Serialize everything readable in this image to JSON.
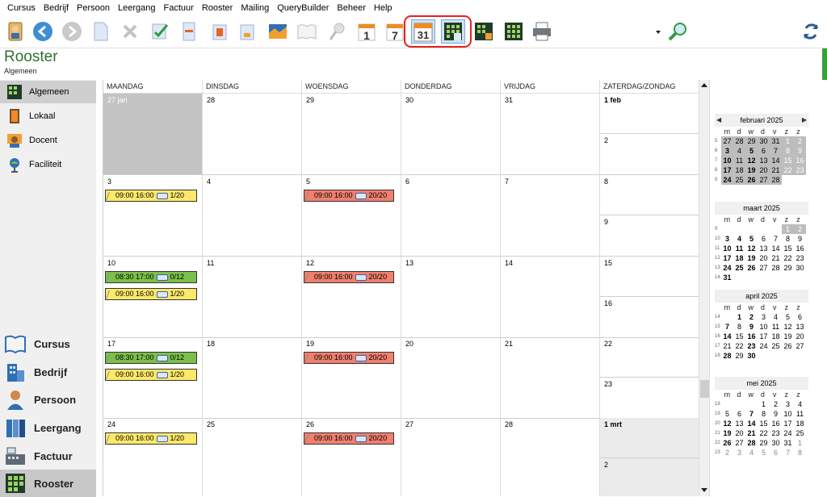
{
  "menu": [
    "Cursus",
    "Bedrijf",
    "Persoon",
    "Leergang",
    "Factuur",
    "Rooster",
    "Mailing",
    "QueryBuilder",
    "Beheer",
    "Help"
  ],
  "toolbar": {
    "icons": [
      "person-badge-icon",
      "back-icon",
      "forward-icon",
      "new-document-icon",
      "delete-icon",
      "approve-icon",
      "form-icon",
      "import-icon",
      "export-icon",
      "map-icon",
      "book-icon",
      "pin-icon",
      "calendar-day-icon",
      "calendar-week-icon",
      "calendar-month-icon",
      "schedule-grid-icon",
      "schedule-orange-icon",
      "schedule-green-icon",
      "print-icon",
      "search-icon",
      "refresh-icon"
    ],
    "day_label": "1",
    "week_label": "7",
    "month_label": "31",
    "highlight_color": "#e8201f"
  },
  "page": {
    "title": "Rooster",
    "subtitle": "Algemeen"
  },
  "sidebar": {
    "top_items": [
      {
        "label": "Algemeen",
        "icon": "schedule-grid-icon",
        "selected": true
      },
      {
        "label": "Lokaal",
        "icon": "door-icon",
        "selected": false
      },
      {
        "label": "Docent",
        "icon": "teacher-icon",
        "selected": false
      },
      {
        "label": "Faciliteit",
        "icon": "projector-icon",
        "selected": false
      }
    ],
    "bottom_items": [
      {
        "label": "Cursus",
        "icon": "book-icon",
        "selected": false
      },
      {
        "label": "Bedrijf",
        "icon": "building-icon",
        "selected": false
      },
      {
        "label": "Persoon",
        "icon": "person-icon",
        "selected": false
      },
      {
        "label": "Leergang",
        "icon": "binders-icon",
        "selected": false
      },
      {
        "label": "Factuur",
        "icon": "cash-register-icon",
        "selected": false
      },
      {
        "label": "Rooster",
        "icon": "schedule-grid-icon",
        "selected": true
      }
    ]
  },
  "calendar": {
    "headers": [
      "MAANDAG",
      "DINSDAG",
      "WOENSDAG",
      "DONDERDAG",
      "VRIJDAG",
      "ZATERDAG/ZONDAG"
    ],
    "weeks": [
      {
        "days": [
          "27 jan",
          "28",
          "29",
          "30",
          "31"
        ],
        "sat": "1 feb",
        "sun": "2",
        "events": []
      },
      {
        "days": [
          "3",
          "4",
          "5",
          "6",
          "7"
        ],
        "sat": "8",
        "sun": "9",
        "events": [
          {
            "day": 0,
            "slot": 0,
            "color": "y",
            "time": "09:00 16:00",
            "count": "1/20"
          },
          {
            "day": 2,
            "slot": 0,
            "color": "r",
            "time": "09:00 16:00",
            "count": "20/20"
          }
        ]
      },
      {
        "days": [
          "10",
          "11",
          "12",
          "13",
          "14"
        ],
        "sat": "15",
        "sun": "16",
        "events": [
          {
            "day": 0,
            "slot": 0,
            "color": "g",
            "time": "08:30 17:00",
            "count": "0/12"
          },
          {
            "day": 0,
            "slot": 1,
            "color": "y",
            "time": "09:00 16:00",
            "count": "1/20"
          },
          {
            "day": 2,
            "slot": 0,
            "color": "r",
            "time": "09:00 16:00",
            "count": "20/20"
          }
        ]
      },
      {
        "days": [
          "17",
          "18",
          "19",
          "20",
          "21"
        ],
        "sat": "22",
        "sun": "23",
        "events": [
          {
            "day": 0,
            "slot": 0,
            "color": "g",
            "time": "08:30 17:00",
            "count": "0/12"
          },
          {
            "day": 0,
            "slot": 1,
            "color": "y",
            "time": "09:00 16:00",
            "count": "1/20"
          },
          {
            "day": 2,
            "slot": 0,
            "color": "r",
            "time": "09:00 16:00",
            "count": "20/20"
          }
        ]
      },
      {
        "days": [
          "24",
          "25",
          "26",
          "27",
          "28"
        ],
        "sat": "1 mrt",
        "sun": "2",
        "events": [
          {
            "day": 0,
            "slot": 0,
            "color": "y",
            "time": "09:00 16:00",
            "count": "1/20"
          },
          {
            "day": 2,
            "slot": 0,
            "color": "r",
            "time": "09:00 16:00",
            "count": "20/20"
          }
        ]
      }
    ]
  },
  "minicals": [
    {
      "title": "februari 2025",
      "nav": true,
      "weekdays": [
        "m",
        "d",
        "w",
        "d",
        "v",
        "z",
        "z"
      ],
      "weeks": [
        {
          "wn": "5",
          "days": [
            [
              "27",
              "g"
            ],
            [
              "28",
              "g"
            ],
            [
              "29",
              "g"
            ],
            [
              "30",
              "g"
            ],
            [
              "31",
              "g"
            ],
            [
              "1",
              "gw"
            ],
            [
              "2",
              "gw"
            ]
          ]
        },
        {
          "wn": "6",
          "days": [
            [
              "3",
              "gb"
            ],
            [
              "4",
              "g"
            ],
            [
              "5",
              "gb"
            ],
            [
              "6",
              "g"
            ],
            [
              "7",
              "g"
            ],
            [
              "8",
              "gw"
            ],
            [
              "9",
              "gw"
            ]
          ]
        },
        {
          "wn": "7",
          "days": [
            [
              "10",
              "gb"
            ],
            [
              "11",
              "g"
            ],
            [
              "12",
              "gb"
            ],
            [
              "13",
              "g"
            ],
            [
              "14",
              "g"
            ],
            [
              "15",
              "gw"
            ],
            [
              "16",
              "gw"
            ]
          ]
        },
        {
          "wn": "8",
          "days": [
            [
              "17",
              "gb"
            ],
            [
              "18",
              "g"
            ],
            [
              "19",
              "gb"
            ],
            [
              "20",
              "g"
            ],
            [
              "21",
              "g"
            ],
            [
              "22",
              "gw"
            ],
            [
              "23",
              "gw"
            ]
          ]
        },
        {
          "wn": "9",
          "days": [
            [
              "24",
              "gb"
            ],
            [
              "25",
              "g"
            ],
            [
              "26",
              "gb"
            ],
            [
              "27",
              "g"
            ],
            [
              "28",
              "g"
            ],
            [
              "",
              ""
            ],
            [
              "",
              ""
            ]
          ]
        }
      ]
    },
    {
      "title": "maart 2025",
      "nav": false,
      "weekdays": [
        "m",
        "d",
        "w",
        "d",
        "v",
        "z",
        "z"
      ],
      "weeks": [
        {
          "wn": "9",
          "days": [
            [
              "",
              ""
            ],
            [
              "",
              ""
            ],
            [
              "",
              ""
            ],
            [
              "",
              ""
            ],
            [
              "",
              ""
            ],
            [
              "1",
              "gw"
            ],
            [
              "2",
              "gw"
            ]
          ]
        },
        {
          "wn": "10",
          "days": [
            [
              "3",
              "b"
            ],
            [
              "4",
              "b"
            ],
            [
              "5",
              "b"
            ],
            [
              "6",
              ""
            ],
            [
              "7",
              ""
            ],
            [
              "8",
              ""
            ],
            [
              "9",
              ""
            ]
          ]
        },
        {
          "wn": "11",
          "days": [
            [
              "10",
              "b"
            ],
            [
              "11",
              "b"
            ],
            [
              "12",
              "b"
            ],
            [
              "13",
              ""
            ],
            [
              "14",
              ""
            ],
            [
              "15",
              ""
            ],
            [
              "16",
              ""
            ]
          ]
        },
        {
          "wn": "12",
          "days": [
            [
              "17",
              "b"
            ],
            [
              "18",
              "b"
            ],
            [
              "19",
              "b"
            ],
            [
              "20",
              ""
            ],
            [
              "21",
              ""
            ],
            [
              "22",
              ""
            ],
            [
              "23",
              ""
            ]
          ]
        },
        {
          "wn": "13",
          "days": [
            [
              "24",
              "b"
            ],
            [
              "25",
              "b"
            ],
            [
              "26",
              "b"
            ],
            [
              "27",
              ""
            ],
            [
              "28",
              ""
            ],
            [
              "29",
              ""
            ],
            [
              "30",
              ""
            ]
          ]
        },
        {
          "wn": "14",
          "days": [
            [
              "31",
              "b"
            ],
            [
              "",
              ""
            ],
            [
              "",
              ""
            ],
            [
              "",
              ""
            ],
            [
              "",
              ""
            ],
            [
              "",
              ""
            ],
            [
              "",
              ""
            ]
          ]
        }
      ]
    },
    {
      "title": "april 2025",
      "nav": false,
      "weekdays": [
        "m",
        "d",
        "w",
        "d",
        "v",
        "z",
        "z"
      ],
      "weeks": [
        {
          "wn": "14",
          "days": [
            [
              "",
              ""
            ],
            [
              "1",
              "b"
            ],
            [
              "2",
              "b"
            ],
            [
              "3",
              ""
            ],
            [
              "4",
              ""
            ],
            [
              "5",
              ""
            ],
            [
              "6",
              ""
            ]
          ]
        },
        {
          "wn": "15",
          "days": [
            [
              "7",
              "b"
            ],
            [
              "8",
              ""
            ],
            [
              "9",
              "b"
            ],
            [
              "10",
              ""
            ],
            [
              "11",
              ""
            ],
            [
              "12",
              ""
            ],
            [
              "13",
              ""
            ]
          ]
        },
        {
          "wn": "16",
          "days": [
            [
              "14",
              "b"
            ],
            [
              "15",
              ""
            ],
            [
              "16",
              "b"
            ],
            [
              "17",
              ""
            ],
            [
              "18",
              ""
            ],
            [
              "19",
              ""
            ],
            [
              "20",
              ""
            ]
          ]
        },
        {
          "wn": "17",
          "days": [
            [
              "21",
              ""
            ],
            [
              "22",
              ""
            ],
            [
              "23",
              "b"
            ],
            [
              "24",
              ""
            ],
            [
              "25",
              ""
            ],
            [
              "26",
              ""
            ],
            [
              "27",
              ""
            ]
          ]
        },
        {
          "wn": "18",
          "days": [
            [
              "28",
              "b"
            ],
            [
              "29",
              ""
            ],
            [
              "30",
              "b"
            ],
            [
              "",
              ""
            ],
            [
              "",
              ""
            ],
            [
              "",
              ""
            ],
            [
              "",
              ""
            ]
          ]
        }
      ]
    },
    {
      "title": "mei 2025",
      "nav": false,
      "weekdays": [
        "m",
        "d",
        "w",
        "d",
        "v",
        "z",
        "z"
      ],
      "weeks": [
        {
          "wn": "18",
          "days": [
            [
              "",
              ""
            ],
            [
              "",
              ""
            ],
            [
              "",
              ""
            ],
            [
              "1",
              ""
            ],
            [
              "2",
              ""
            ],
            [
              "3",
              ""
            ],
            [
              "4",
              ""
            ]
          ]
        },
        {
          "wn": "19",
          "days": [
            [
              "5",
              ""
            ],
            [
              "6",
              ""
            ],
            [
              "7",
              "b"
            ],
            [
              "8",
              ""
            ],
            [
              "9",
              ""
            ],
            [
              "10",
              ""
            ],
            [
              "11",
              ""
            ]
          ]
        },
        {
          "wn": "20",
          "days": [
            [
              "12",
              "b"
            ],
            [
              "13",
              ""
            ],
            [
              "14",
              "b"
            ],
            [
              "15",
              ""
            ],
            [
              "16",
              ""
            ],
            [
              "17",
              ""
            ],
            [
              "18",
              ""
            ]
          ]
        },
        {
          "wn": "21",
          "days": [
            [
              "19",
              "b"
            ],
            [
              "20",
              ""
            ],
            [
              "21",
              "b"
            ],
            [
              "22",
              ""
            ],
            [
              "23",
              ""
            ],
            [
              "24",
              ""
            ],
            [
              "25",
              ""
            ]
          ]
        },
        {
          "wn": "22",
          "days": [
            [
              "26",
              "b"
            ],
            [
              "27",
              ""
            ],
            [
              "28",
              "b"
            ],
            [
              "29",
              ""
            ],
            [
              "30",
              ""
            ],
            [
              "31",
              ""
            ],
            [
              "1",
              "o"
            ]
          ]
        },
        {
          "wn": "23",
          "days": [
            [
              "2",
              "o"
            ],
            [
              "3",
              "o"
            ],
            [
              "4",
              "o"
            ],
            [
              "5",
              "o"
            ],
            [
              "6",
              "o"
            ],
            [
              "7",
              "o"
            ],
            [
              "8",
              "o"
            ]
          ]
        }
      ]
    }
  ]
}
